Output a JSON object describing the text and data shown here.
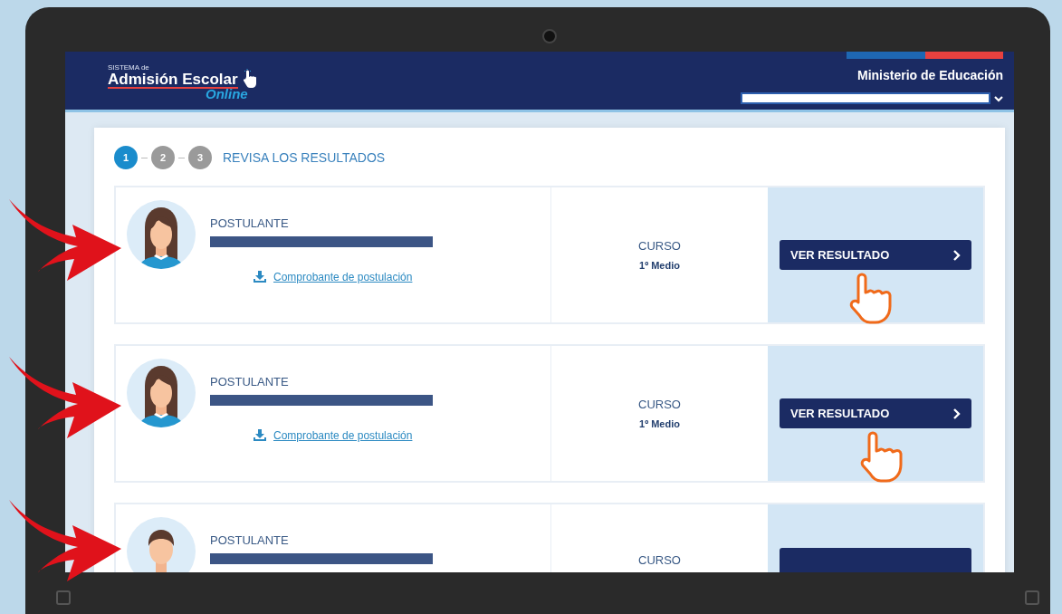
{
  "header": {
    "logo_small": "SISTEMA de",
    "logo_main": "Admisión Escolar",
    "logo_script": "Online",
    "ministry": "Ministerio de Educación"
  },
  "steps": [
    {
      "label": "1",
      "selected": true
    },
    {
      "label": "2",
      "selected": false
    },
    {
      "label": "3",
      "selected": false
    }
  ],
  "step_title": "REVISA LOS RESULTADOS",
  "applicants": [
    {
      "kind": "female",
      "role": "POSTULANTE",
      "receipt_link": "Comprobante de postulación",
      "course_label": "CURSO",
      "course": "1º Medio",
      "button": "VER RESULTADO"
    },
    {
      "kind": "female",
      "role": "POSTULANTE",
      "receipt_link": "Comprobante de postulación",
      "course_label": "CURSO",
      "course": "1º Medio",
      "button": "VER RESULTADO"
    },
    {
      "kind": "male",
      "role": "POSTULANTE",
      "course_label": "CURSO"
    }
  ]
}
